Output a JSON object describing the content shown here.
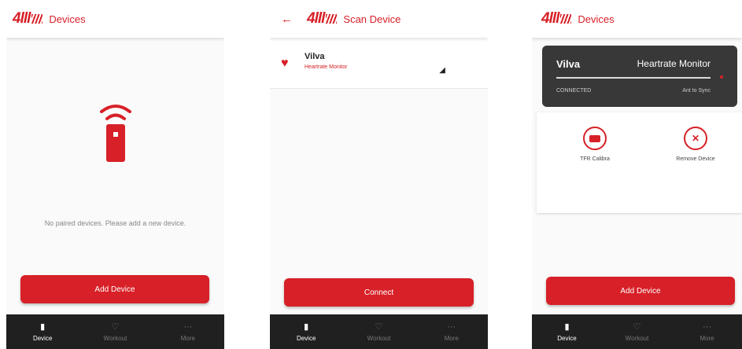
{
  "brand": {
    "mark": "4lll"
  },
  "screens": [
    {
      "title": "Devices",
      "empty_message": "No paired devices. Please add a new device.",
      "button_label": "Add Device",
      "tabs": [
        {
          "label": "Device"
        },
        {
          "label": "Workout"
        },
        {
          "label": "More"
        }
      ]
    },
    {
      "title": "Scan Device",
      "device_name": "Vilva",
      "device_type": "Heartrate Monitor",
      "button_label": "Connect",
      "tabs": [
        {
          "label": "Device"
        },
        {
          "label": "Workout"
        },
        {
          "label": "More"
        }
      ]
    },
    {
      "title": "Devices",
      "card": {
        "name": "Vilva",
        "type": "Heartrate Monitor",
        "status": "CONNECTED",
        "right_text": "Ant to Sync"
      },
      "actions": [
        {
          "label": "TFR Calibra"
        },
        {
          "label": "Remove Device"
        }
      ],
      "button_label": "Add Device",
      "tabs": [
        {
          "label": "Device"
        },
        {
          "label": "Workout"
        },
        {
          "label": "More"
        }
      ]
    }
  ],
  "colors": {
    "accent": "#d72027",
    "bottom_bar": "#202020",
    "card": "#383838"
  },
  "icons": [
    "back-arrow-icon",
    "remote-signal-icon",
    "heart-icon",
    "signal-icon",
    "calibrate-icon",
    "remove-icon",
    "device-tab-icon",
    "workout-tab-icon",
    "more-tab-icon"
  ]
}
